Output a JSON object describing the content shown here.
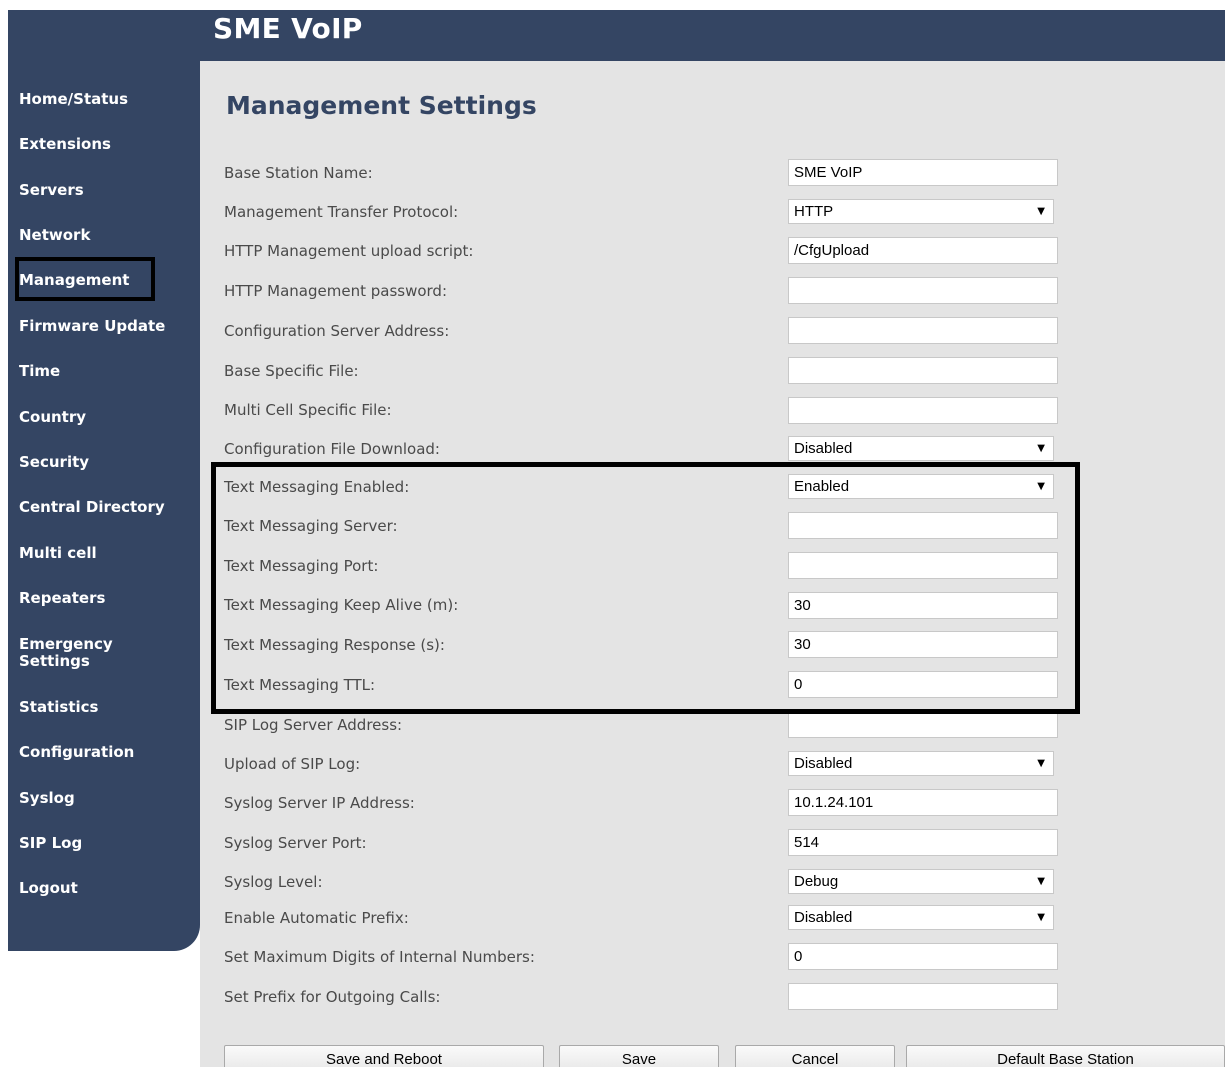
{
  "app": {
    "title": "SME VoIP"
  },
  "sidebar": {
    "items": [
      {
        "label": "Home/Status"
      },
      {
        "label": "Extensions"
      },
      {
        "label": "Servers"
      },
      {
        "label": "Network"
      },
      {
        "label": "Management",
        "selected": true
      },
      {
        "label": "Firmware Update"
      },
      {
        "label": "Time"
      },
      {
        "label": "Country"
      },
      {
        "label": "Security"
      },
      {
        "label": "Central Directory"
      },
      {
        "label": "Multi cell"
      },
      {
        "label": "Repeaters"
      },
      {
        "label": "Emergency Settings"
      },
      {
        "label": "Statistics"
      },
      {
        "label": "Configuration"
      },
      {
        "label": "Syslog"
      },
      {
        "label": "SIP Log"
      },
      {
        "label": "Logout"
      }
    ]
  },
  "page": {
    "title": "Management Settings"
  },
  "fields": [
    {
      "label": "Base Station Name:",
      "type": "text",
      "value": "SME VoIP"
    },
    {
      "label": "Management Transfer Protocol:",
      "type": "select",
      "value": "HTTP"
    },
    {
      "label": "HTTP Management upload script:",
      "type": "text",
      "value": "/CfgUpload"
    },
    {
      "label": "HTTP Management password:",
      "type": "text",
      "value": ""
    },
    {
      "label": "Configuration Server Address:",
      "type": "text",
      "value": ""
    },
    {
      "label": "Base Specific File:",
      "type": "text",
      "value": ""
    },
    {
      "label": "Multi Cell Specific File:",
      "type": "text",
      "value": ""
    },
    {
      "label": "Configuration File Download:",
      "type": "select",
      "value": "Disabled"
    },
    {
      "label": "Text Messaging Enabled:",
      "type": "select",
      "value": "Enabled"
    },
    {
      "label": "Text Messaging Server:",
      "type": "text",
      "value": ""
    },
    {
      "label": "Text Messaging Port:",
      "type": "text",
      "value": ""
    },
    {
      "label": "Text Messaging Keep Alive (m):",
      "type": "text",
      "value": "30"
    },
    {
      "label": "Text Messaging Response (s):",
      "type": "text",
      "value": "30"
    },
    {
      "label": "Text Messaging TTL:",
      "type": "text",
      "value": "0"
    },
    {
      "label": "SIP Log Server Address:",
      "type": "text",
      "value": ""
    },
    {
      "label": "Upload of SIP Log:",
      "type": "select",
      "value": "Disabled"
    },
    {
      "label": "Syslog Server IP Address:",
      "type": "text",
      "value": "10.1.24.101"
    },
    {
      "label": "Syslog Server Port:",
      "type": "text",
      "value": "514"
    },
    {
      "label": "Syslog Level:",
      "type": "select",
      "value": "Debug"
    },
    {
      "label": "Enable Automatic Prefix:",
      "type": "select",
      "value": "Disabled"
    },
    {
      "label": "Set Maximum Digits of Internal Numbers:",
      "type": "text",
      "value": "0"
    },
    {
      "label": "Set Prefix for Outgoing Calls:",
      "type": "text",
      "value": ""
    }
  ],
  "buttons": [
    {
      "label": "Save and Reboot"
    },
    {
      "label": "Save"
    },
    {
      "label": "Cancel"
    },
    {
      "label": "Default Base Station"
    }
  ],
  "colors": {
    "navy": "#344563",
    "content_bg": "#e4e4e4",
    "highlight_border": "#000000"
  }
}
